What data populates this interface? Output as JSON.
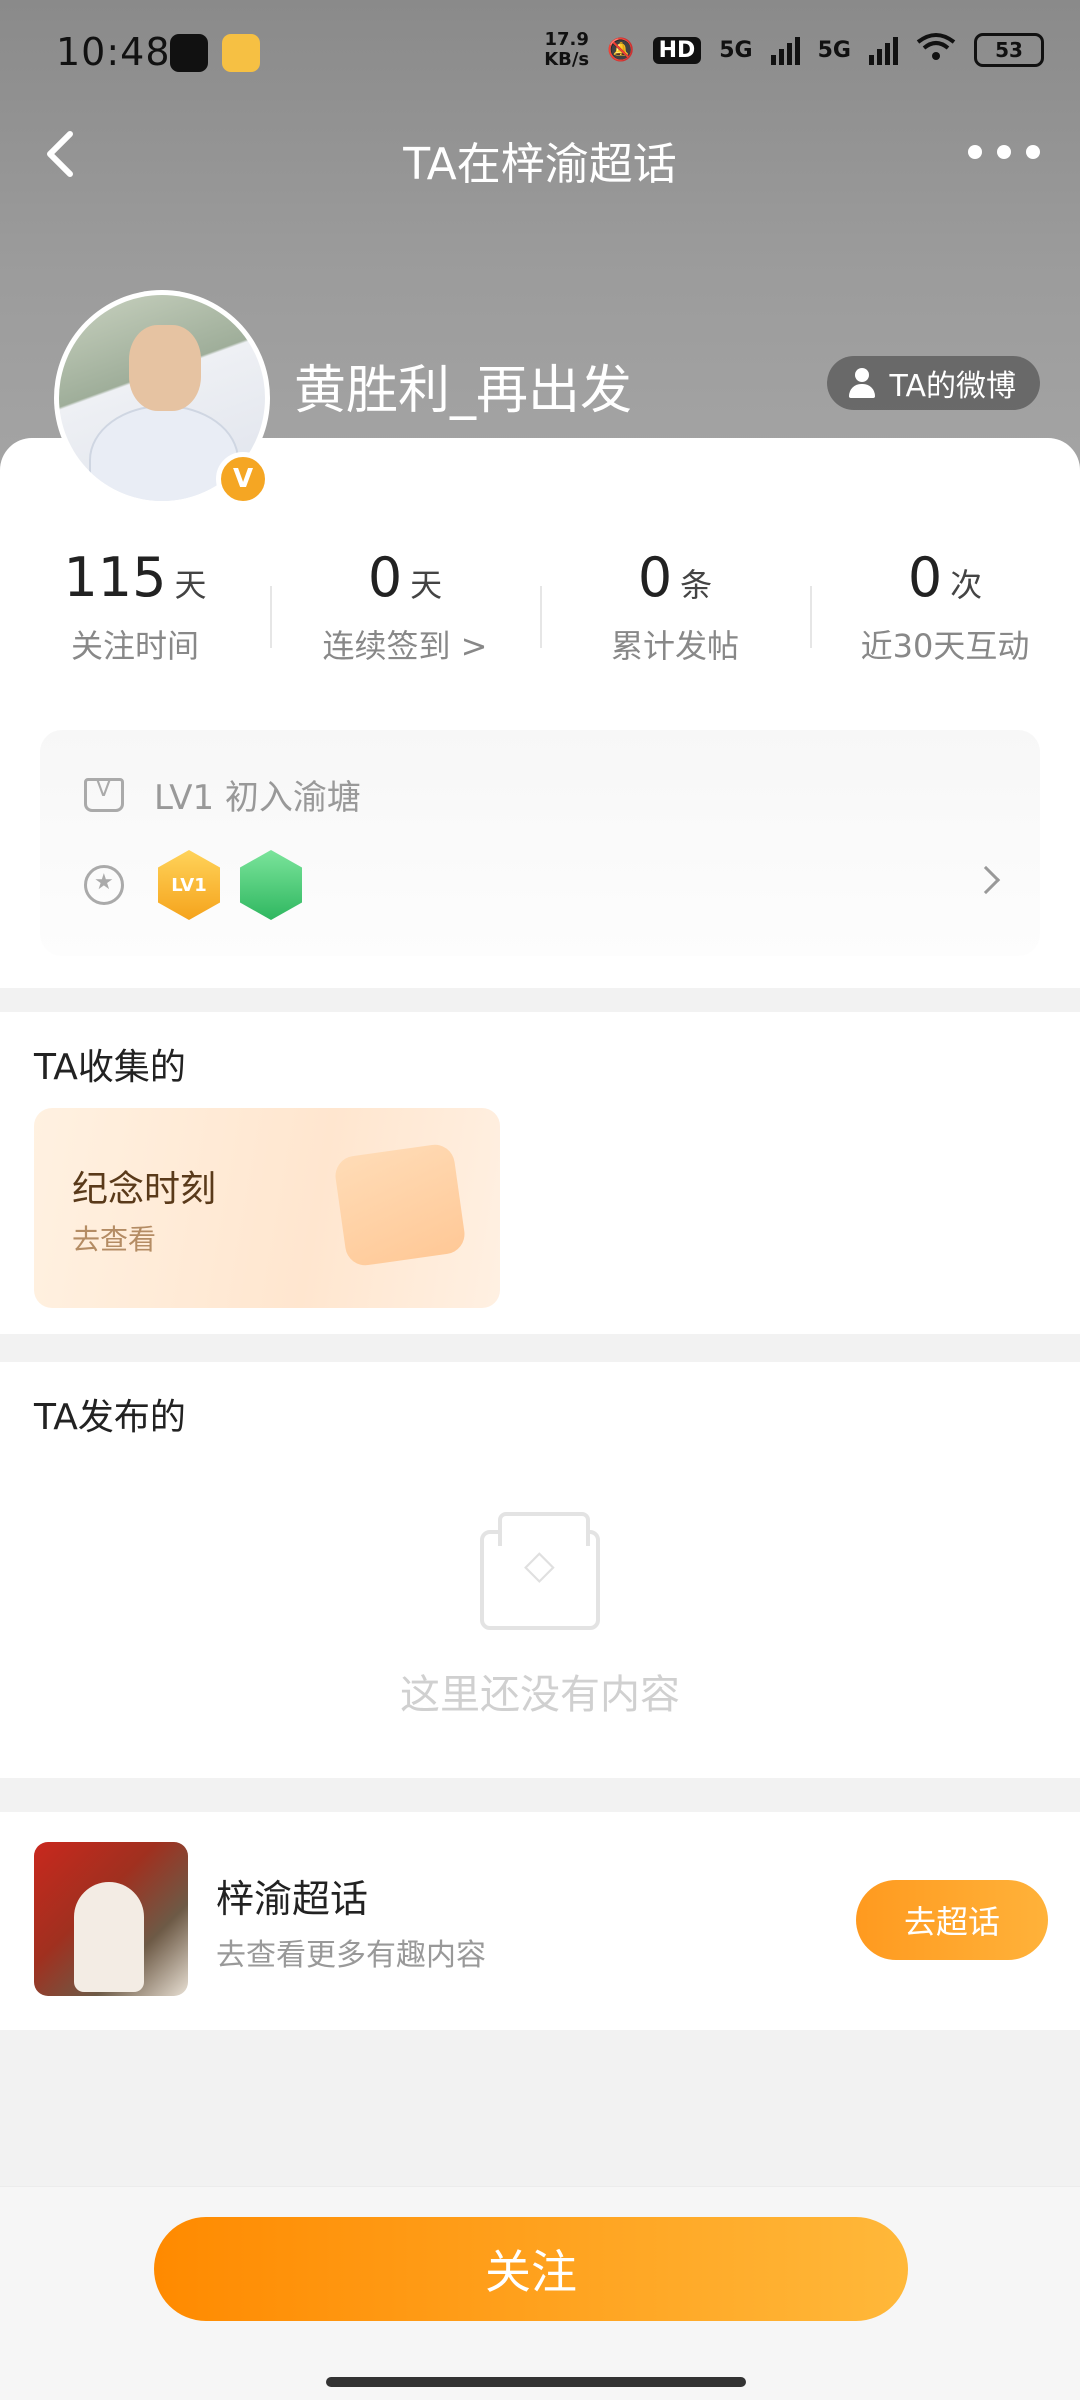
{
  "status_bar": {
    "time": "10:48",
    "net_speed_value": "17.9",
    "net_speed_unit": "KB/s",
    "hd_label": "HD",
    "sim1": "5G",
    "sim2": "5G",
    "battery": "53"
  },
  "header": {
    "title": "TA在梓渝超话"
  },
  "profile": {
    "username": "黄胜利_再出发",
    "verified_mark": "V",
    "weibo_link_label": "TA的微博"
  },
  "stats": [
    {
      "value": "115",
      "unit": "天",
      "label": "关注时间"
    },
    {
      "value": "0",
      "unit": "天",
      "label": "连续签到 >"
    },
    {
      "value": "0",
      "unit": "条",
      "label": "累计发帖"
    },
    {
      "value": "0",
      "unit": "次",
      "label": "近30天互动"
    }
  ],
  "level": {
    "text": "LV1 初入渝塘",
    "badges": [
      "LV1",
      ""
    ]
  },
  "collected": {
    "section_title": "TA收集的",
    "card_title": "纪念时刻",
    "card_subtitle": "去查看"
  },
  "published": {
    "section_title": "TA发布的",
    "empty_text": "这里还没有内容"
  },
  "chaohua": {
    "name": "梓渝超话",
    "desc": "去查看更多有趣内容",
    "button": "去超话"
  },
  "bottom": {
    "follow_button": "关注"
  },
  "colors": {
    "accent": "#ff9a1f",
    "header_bg": "#9b9b9b"
  }
}
